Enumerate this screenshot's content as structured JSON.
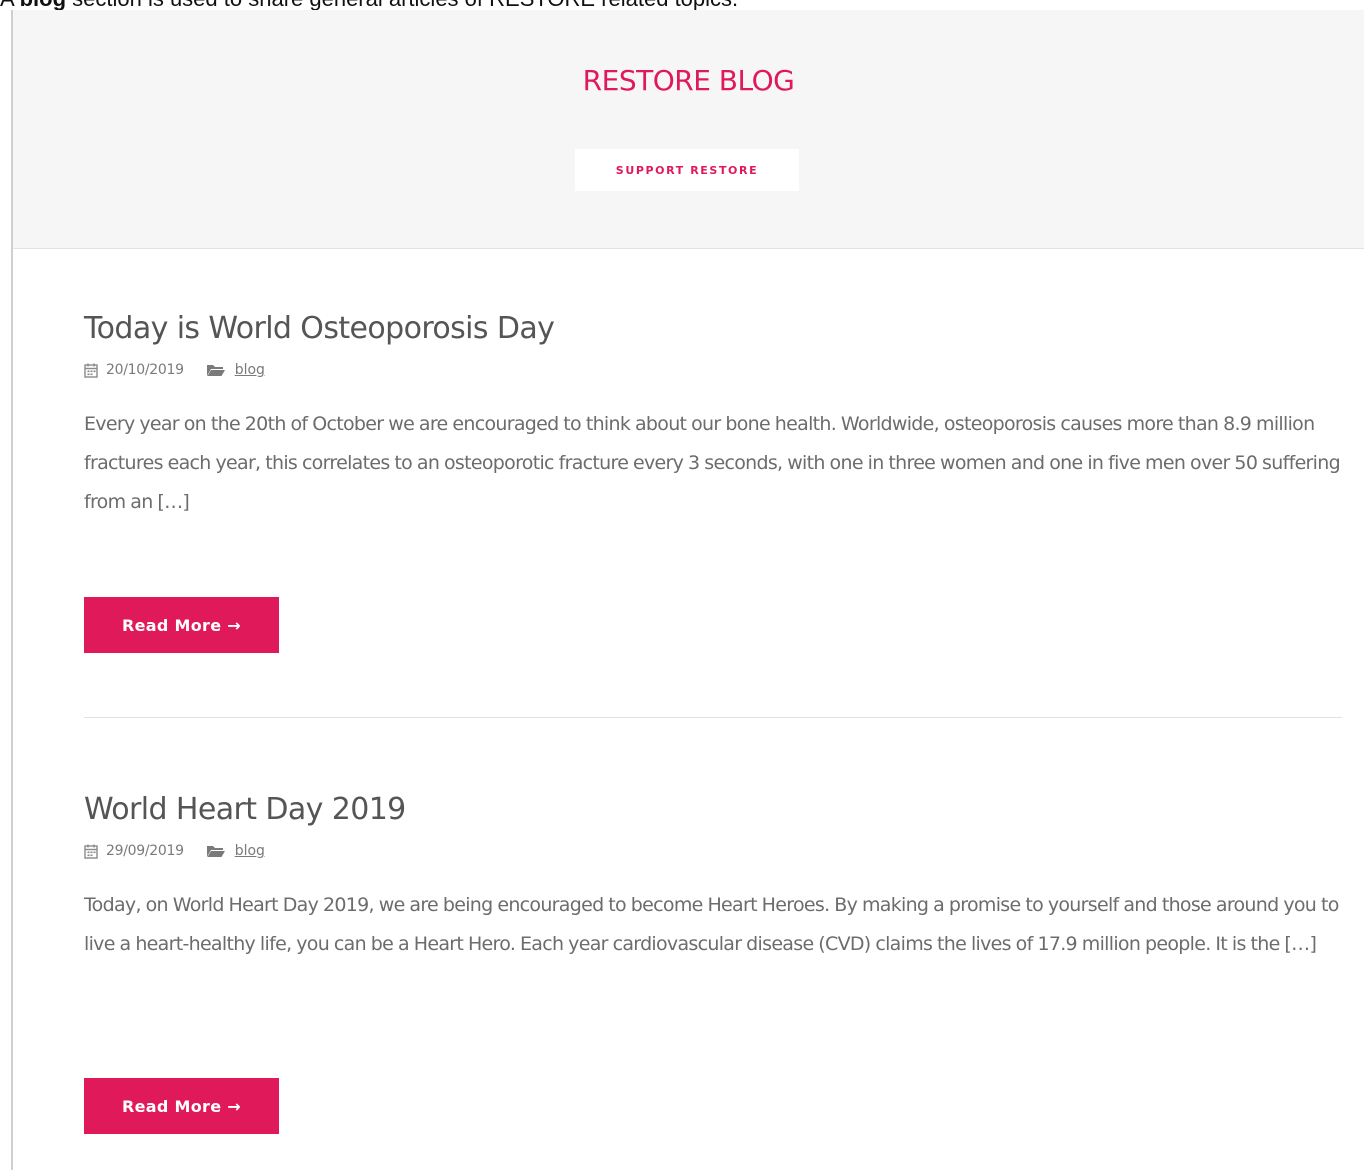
{
  "caption": {
    "prefix": "A ",
    "bold": "blog",
    "suffix": " section is used to share general articles of RESTORE related topics."
  },
  "hero": {
    "title": "RESTORE BLOG",
    "support_label": "SUPPORT RESTORE"
  },
  "posts": [
    {
      "title": "Today is World Osteoporosis Day",
      "date": "20/10/2019",
      "category": "blog",
      "excerpt": "Every year on the 20th of October we are encouraged to think about our bone health. Worldwide, osteoporosis causes more than 8.9 million fractures each year, this correlates to an osteoporotic fracture every 3 seconds, with one in three women and one in five men over 50 suffering from an […]",
      "read_more": "Read More →"
    },
    {
      "title": "World Heart Day 2019",
      "date": "29/09/2019",
      "category": "blog",
      "excerpt": "Today, on World Heart Day 2019, we are being encouraged to become Heart Heroes. By making a promise to yourself and those around you to live a heart-healthy life, you can be a Heart Hero. Each year cardiovascular disease (CVD) claims the lives of 17.9 million people. It is the […]",
      "read_more": "Read More →"
    }
  ],
  "colors": {
    "accent": "#e0195a",
    "hero_bg": "#f6f6f6",
    "text_muted": "#6c6c6c"
  },
  "icons": {
    "date": "calendar-icon",
    "category": "folder-icon"
  }
}
